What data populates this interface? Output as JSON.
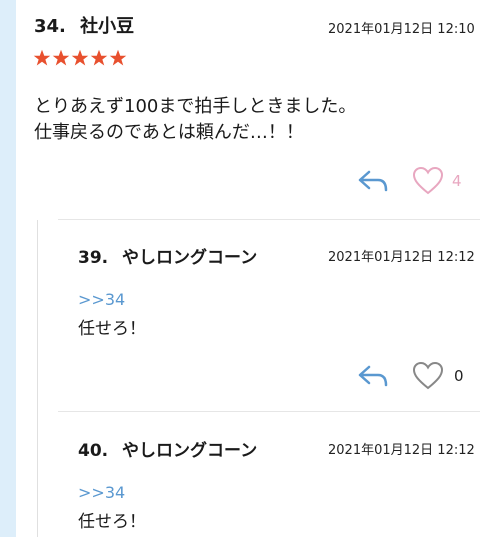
{
  "comments": [
    {
      "number": "34.",
      "name": "社小豆",
      "date": "2021年01月12日 12:10",
      "rating": 5,
      "body": "とりあえず100まで拍手しときました。\n仕事戻るのであとは頼んだ…！！",
      "likes": "4"
    },
    {
      "number": "39.",
      "name": "やしロングコーン",
      "date": "2021年01月12日 12:12",
      "anchor": ">>34",
      "body": "任せろ！",
      "likes": "0"
    },
    {
      "number": "40.",
      "name": "やしロングコーン",
      "date": "2021年01月12日 12:12",
      "anchor": ">>34",
      "body": "任せろ！"
    }
  ],
  "colors": {
    "star": "#e8502e",
    "reply": "#5a98d0",
    "heart_liked": "#e8a7c0",
    "heart_plain": "#888888",
    "anchor": "#5a98d0"
  }
}
